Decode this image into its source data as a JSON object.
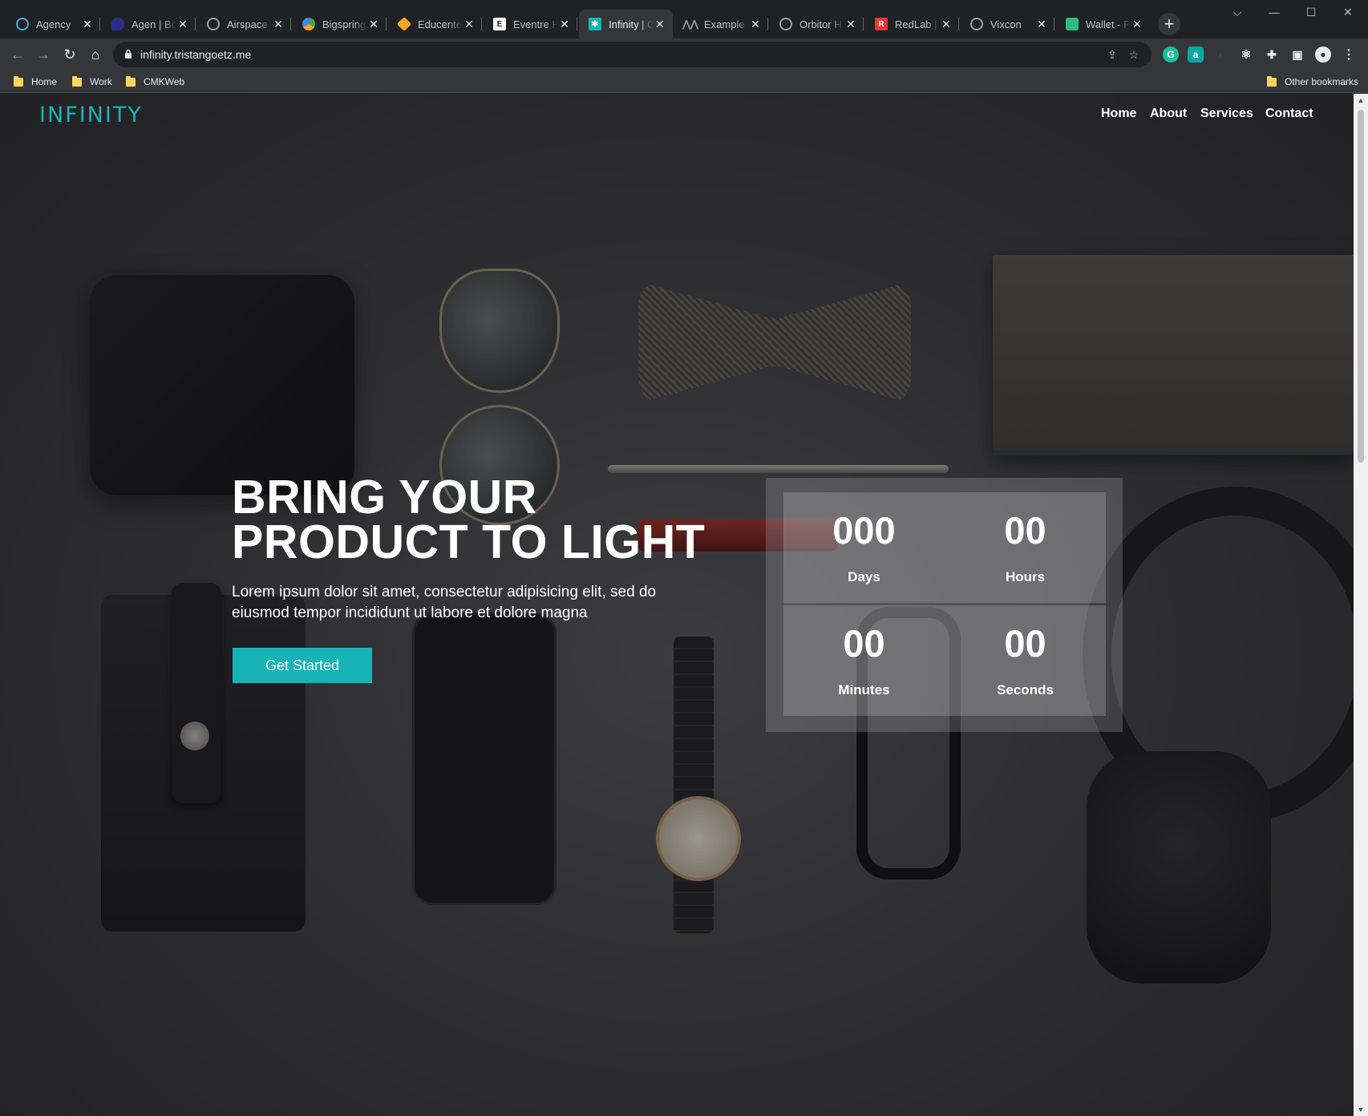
{
  "browser": {
    "tabs": [
      {
        "title": "Agency",
        "icon": "agency-favicon",
        "color": "#4fa6d8"
      },
      {
        "title": "Agen | Bo",
        "icon": "agen-favicon",
        "color": "#2a2f8f"
      },
      {
        "title": "Airspace |",
        "icon": "globe-favicon",
        "color": "#9aa0a6"
      },
      {
        "title": "Bigspring",
        "icon": "bigspring-favicon",
        "color": "#36a852"
      },
      {
        "title": "Educenter",
        "icon": "educenter-favicon",
        "color": "#f5a623"
      },
      {
        "title": "Eventre H",
        "icon": "eventre-favicon",
        "color": "#ffffff"
      },
      {
        "title": "Infinity | C",
        "icon": "infinity-favicon",
        "color": "#17b3b6"
      },
      {
        "title": "Example s",
        "icon": "example-favicon",
        "color": "#9aa0a6"
      },
      {
        "title": "Orbitor H",
        "icon": "globe-favicon",
        "color": "#9aa0a6"
      },
      {
        "title": "RedLab | P",
        "icon": "redlab-favicon",
        "color": "#e53935"
      },
      {
        "title": "Vixcon",
        "icon": "globe-favicon",
        "color": "#9aa0a6"
      },
      {
        "title": "Wallet - P",
        "icon": "wallet-favicon",
        "color": "#2bbd7e"
      }
    ],
    "active_tab_index": 6,
    "url": "infinity.tristangoetz.me",
    "bookmarks": [
      "Home",
      "Work",
      "CMKWeb"
    ],
    "other_bookmarks": "Other bookmarks"
  },
  "site": {
    "logo": "INFINITY",
    "nav": [
      "Home",
      "About",
      "Services",
      "Contact"
    ],
    "hero": {
      "title_line1": "BRING YOUR",
      "title_line2": "PRODUCT TO LIGHT",
      "text": "Lorem ipsum dolor sit amet, consectetur adipisicing elit, sed do eiusmod tempor incididunt ut labore et dolore magna",
      "cta": "Get Started"
    },
    "countdown": {
      "days": "000",
      "days_label": "Days",
      "hours": "00",
      "hours_label": "Hours",
      "minutes": "00",
      "minutes_label": "Minutes",
      "seconds": "00",
      "seconds_label": "Seconds"
    },
    "accent_color": "#17b3b6"
  }
}
